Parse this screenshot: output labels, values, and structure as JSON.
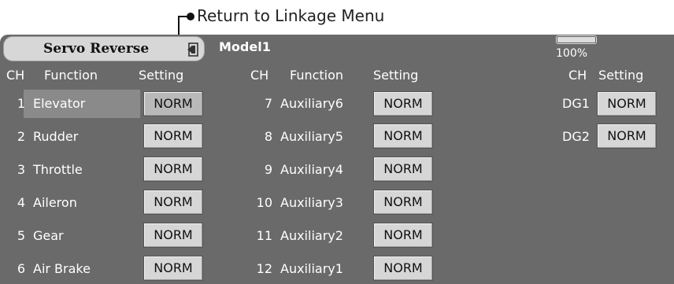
{
  "annotation": {
    "text": "Return to Linkage Menu"
  },
  "header": {
    "title": "Servo Reverse",
    "model": "Model1",
    "battery_percent": "100%",
    "battery_level": 1.0
  },
  "columns": {
    "left": {
      "ch": "CH",
      "function": "Function",
      "setting": "Setting"
    },
    "middle": {
      "ch": "CH",
      "function": "Function",
      "setting": "Setting"
    },
    "right": {
      "ch": "CH",
      "setting": "Setting"
    }
  },
  "channels_left": [
    {
      "ch": "1",
      "function": "Elevator",
      "setting": "NORM",
      "selected": true
    },
    {
      "ch": "2",
      "function": "Rudder",
      "setting": "NORM"
    },
    {
      "ch": "3",
      "function": "Throttle",
      "setting": "NORM"
    },
    {
      "ch": "4",
      "function": "Aileron",
      "setting": "NORM"
    },
    {
      "ch": "5",
      "function": "Gear",
      "setting": "NORM"
    },
    {
      "ch": "6",
      "function": "Air Brake",
      "setting": "NORM"
    }
  ],
  "channels_middle": [
    {
      "ch": "7",
      "function": "Auxiliary6",
      "setting": "NORM"
    },
    {
      "ch": "8",
      "function": "Auxiliary5",
      "setting": "NORM"
    },
    {
      "ch": "9",
      "function": "Auxiliary4",
      "setting": "NORM"
    },
    {
      "ch": "10",
      "function": "Auxiliary3",
      "setting": "NORM"
    },
    {
      "ch": "11",
      "function": "Auxiliary2",
      "setting": "NORM"
    },
    {
      "ch": "12",
      "function": "Auxiliary1",
      "setting": "NORM"
    }
  ],
  "channels_right": [
    {
      "ch": "DG1",
      "setting": "NORM"
    },
    {
      "ch": "DG2",
      "setting": "NORM"
    }
  ],
  "colors": {
    "screen_bg": "#6a6a6a",
    "button_bg": "#d6d6d6",
    "text_on_screen": "#ffffff"
  }
}
